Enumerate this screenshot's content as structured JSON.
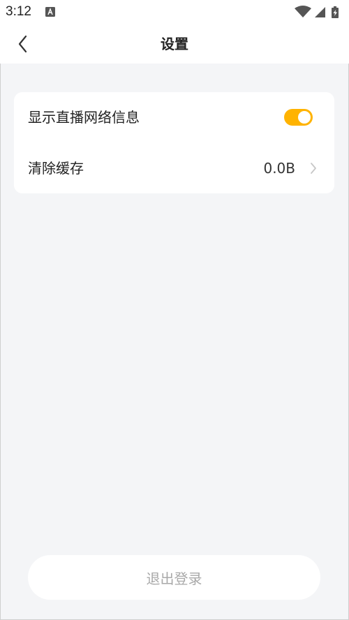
{
  "status_bar": {
    "time": "3:12",
    "icons": [
      "a-notification-icon",
      "wifi-icon",
      "signal-icon",
      "battery-icon"
    ]
  },
  "header": {
    "title": "设置",
    "back_icon": "chevron-left-icon"
  },
  "settings": {
    "items": [
      {
        "label": "显示直播网络信息",
        "type": "toggle",
        "enabled": true
      },
      {
        "label": "清除缓存",
        "value": "0.0B",
        "type": "navigation",
        "icon": "chevron-right-icon"
      }
    ]
  },
  "logout": {
    "label": "退出登录"
  },
  "colors": {
    "accent": "#ffb300",
    "background": "#f4f5f7",
    "card": "#ffffff",
    "text": "#222222",
    "muted_text": "#a9a9a9"
  }
}
